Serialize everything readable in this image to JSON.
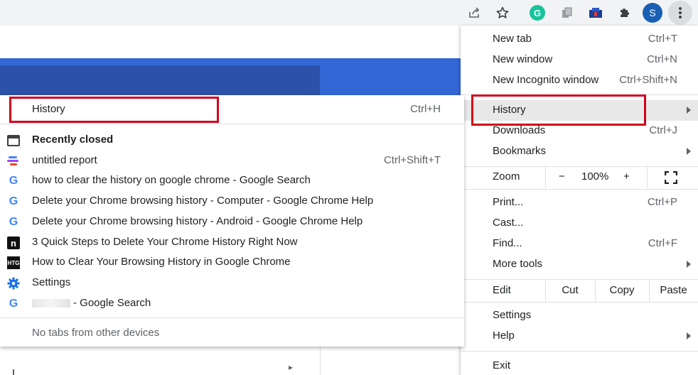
{
  "toolbar": {
    "avatar_letter": "S",
    "grammarly_letter": "G",
    "icons": [
      "share-icon",
      "star-icon",
      "grammarly-icon",
      "extension-icon",
      "extension-icon",
      "puzzle-icon",
      "avatar",
      "more-vert-icon"
    ]
  },
  "main_menu": {
    "new_tab": {
      "label": "New tab",
      "shortcut": "Ctrl+T"
    },
    "new_window": {
      "label": "New window",
      "shortcut": "Ctrl+N"
    },
    "new_incognito": {
      "label": "New Incognito window",
      "shortcut": "Ctrl+Shift+N"
    },
    "history": {
      "label": "History"
    },
    "downloads": {
      "label": "Downloads",
      "shortcut": "Ctrl+J"
    },
    "bookmarks": {
      "label": "Bookmarks"
    },
    "zoom": {
      "label": "Zoom",
      "minus": "−",
      "level": "100%",
      "plus": "+"
    },
    "print": {
      "label": "Print...",
      "shortcut": "Ctrl+P"
    },
    "cast": {
      "label": "Cast..."
    },
    "find": {
      "label": "Find...",
      "shortcut": "Ctrl+F"
    },
    "more_tools": {
      "label": "More tools"
    },
    "edit": {
      "label": "Edit",
      "cut": "Cut",
      "copy": "Copy",
      "paste": "Paste"
    },
    "settings": {
      "label": "Settings"
    },
    "help": {
      "label": "Help"
    },
    "exit": {
      "label": "Exit"
    }
  },
  "history_submenu": {
    "history": {
      "label": "History",
      "shortcut": "Ctrl+H"
    },
    "recently_closed": "Recently closed",
    "items": [
      {
        "icon": "docs-icon",
        "label": "untitled report",
        "shortcut": "Ctrl+Shift+T"
      },
      {
        "icon": "google-icon",
        "label": "how to clear the history on google chrome - Google Search"
      },
      {
        "icon": "google-icon",
        "label": "Delete your Chrome browsing history - Computer - Google Chrome Help"
      },
      {
        "icon": "google-icon",
        "label": "Delete your Chrome browsing history - Android - Google Chrome Help"
      },
      {
        "icon": "n-icon",
        "label": "3 Quick Steps to Delete Your Chrome History Right Now"
      },
      {
        "icon": "htg-icon",
        "label": "How to Clear Your Browsing History in Google Chrome"
      },
      {
        "icon": "settings-gear-icon",
        "label": "Settings"
      },
      {
        "icon": "google-icon",
        "label": "- Google Search"
      }
    ],
    "no_tabs": "No tabs from other devices",
    "n_icon_text": "n",
    "htg_icon_text": "HTG",
    "google_icon_text": "G"
  },
  "colors": {
    "highlight": "#d0021b",
    "page_blue": "#3367d6",
    "grammarly": "#15c39a",
    "avatar": "#1a5fb4"
  }
}
